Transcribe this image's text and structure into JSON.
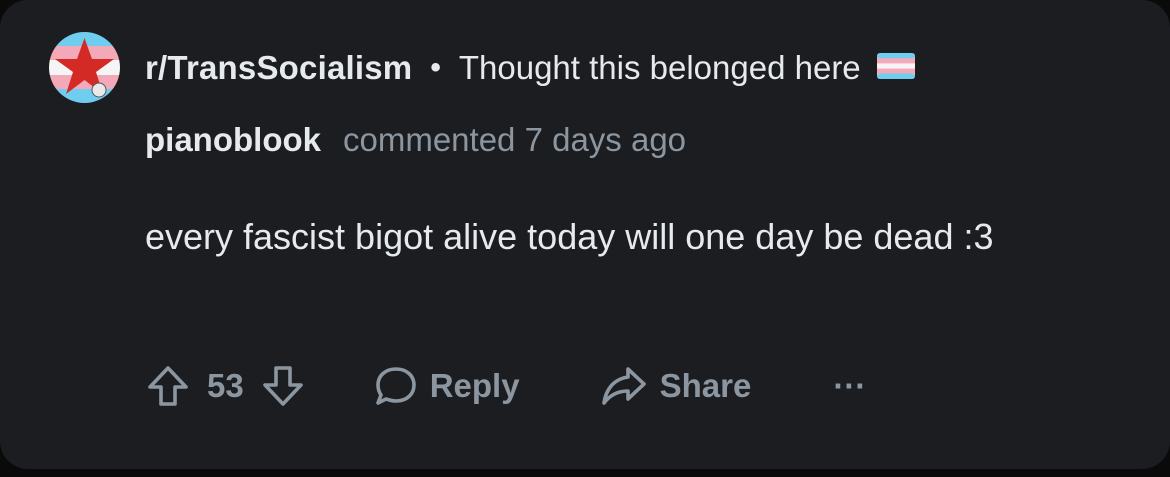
{
  "post": {
    "subreddit": "r/TransSocialism",
    "separator": "•",
    "title": "Thought this belonged here",
    "flag_icon": "trans-flag-icon"
  },
  "comment": {
    "author": "pianoblook",
    "meta": "commented 7 days ago",
    "body": "every fascist bigot alive today will one day be dead :3"
  },
  "actions": {
    "vote_count": "53",
    "reply_label": "Reply",
    "share_label": "Share",
    "more_label": "···"
  },
  "colors": {
    "card_background": "#1b1d20",
    "primary_text": "#e7eaec",
    "secondary_text": "#8c96a0",
    "trans_blue": "#6fcdf0",
    "trans_pink": "#f4a9b9",
    "avatar_star": "#d42a26"
  }
}
